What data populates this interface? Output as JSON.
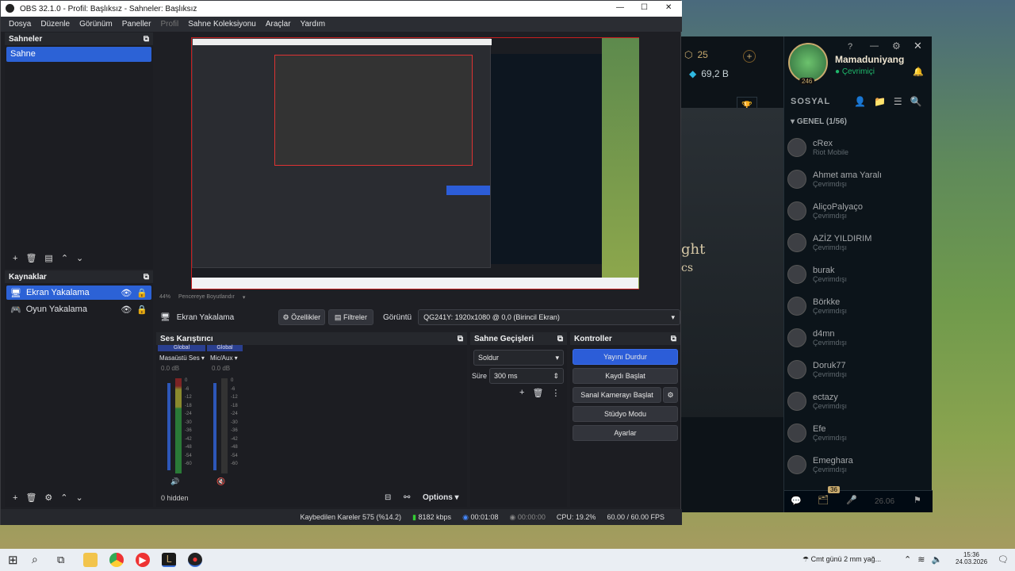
{
  "window": {
    "title": "OBS 32.1.0 - Profil: Başlıksız - Sahneler: Başlıksız",
    "controls": [
      "—",
      "☐",
      "✕"
    ]
  },
  "menu": [
    "Dosya",
    "Düzenle",
    "Görünüm",
    "Paneller",
    "Profil",
    "Sahne Koleksiyonu",
    "Araçlar",
    "Yardım"
  ],
  "scenes": {
    "title": "Sahneler",
    "items": [
      "Sahne"
    ],
    "selected": 0
  },
  "sources": {
    "title": "Kaynaklar",
    "items": [
      {
        "label": "Ekran Yakalama",
        "selected": true
      },
      {
        "label": "Oyun Yakalama",
        "selected": false
      }
    ]
  },
  "preview_bar": {
    "zoom": "44%",
    "fit": "Pencereye Boyutlandır"
  },
  "source_toolbar": {
    "source_name": "Ekran Yakalama",
    "properties": "Özellikler",
    "filters": "Filtreler",
    "display_label": "Görüntü",
    "display_value": "QG241Y: 1920x1080 @ 0,0 (Birincil Ekran)"
  },
  "mixer": {
    "title": "Ses Karıştırıcı",
    "channels": [
      {
        "tag": "Global",
        "name": "Masaüstü Ses",
        "db": "0.0 dB"
      },
      {
        "tag": "Global",
        "name": "Mic/Aux",
        "db": "0.0 dB"
      }
    ],
    "scale": [
      "0",
      "-6",
      "-12",
      "-18",
      "-24",
      "-30",
      "-36",
      "-42",
      "-48",
      "-54",
      "-60"
    ],
    "hidden": "0 hidden",
    "options": "Options"
  },
  "transitions": {
    "title": "Sahne Geçişleri",
    "type": "Soldur",
    "duration_label": "Süre",
    "duration": "300 ms"
  },
  "controls": {
    "title": "Kontroller",
    "buttons": [
      "Yayını Durdur",
      "Kaydı Başlat",
      "Sanal Kamerayı Başlat",
      "Stüdyo Modu",
      "Ayarlar"
    ]
  },
  "status": {
    "dropped": "Kaybedilen Kareler 575 (%14.2)",
    "bitrate": "8182 kbps",
    "stream_time": "00:01:08",
    "rec_time": "00:00:00",
    "cpu": "CPU: 19.2%",
    "fps": "60.00 / 60.00 FPS"
  },
  "lol": {
    "rp": "25",
    "be": "69,2 B",
    "username": "Mamaduniyang",
    "status": "Çevrimiçi",
    "level": "246",
    "social": "SOSYAL",
    "group": "GENEL (1/56)",
    "friends": [
      {
        "name": "cRex",
        "status": "Riot Mobile"
      },
      {
        "name": "Ahmet ama Yaralı",
        "status": "Çevrimdışı"
      },
      {
        "name": "AliçoPalyaço",
        "status": "Çevrimdışı"
      },
      {
        "name": "AZİZ YILDIRIM",
        "status": "Çevrimdışı"
      },
      {
        "name": "burak",
        "status": "Çevrimdışı"
      },
      {
        "name": "Börkke",
        "status": "Çevrimdışı"
      },
      {
        "name": "d4mn",
        "status": "Çevrimdışı"
      },
      {
        "name": "Doruk77",
        "status": "Çevrimdışı"
      },
      {
        "name": "ectazy",
        "status": "Çevrimdışı"
      },
      {
        "name": "Efe",
        "status": "Çevrimdışı"
      },
      {
        "name": "Emeghara",
        "status": "Çevrimdışı"
      }
    ],
    "badge": "36",
    "patch": "26.06",
    "banner_text": [
      "ght",
      "cs"
    ]
  },
  "taskbar": {
    "weather": "Cmt günü 2 mm yağ...",
    "time": "15:36",
    "date": "24.03.2026"
  }
}
